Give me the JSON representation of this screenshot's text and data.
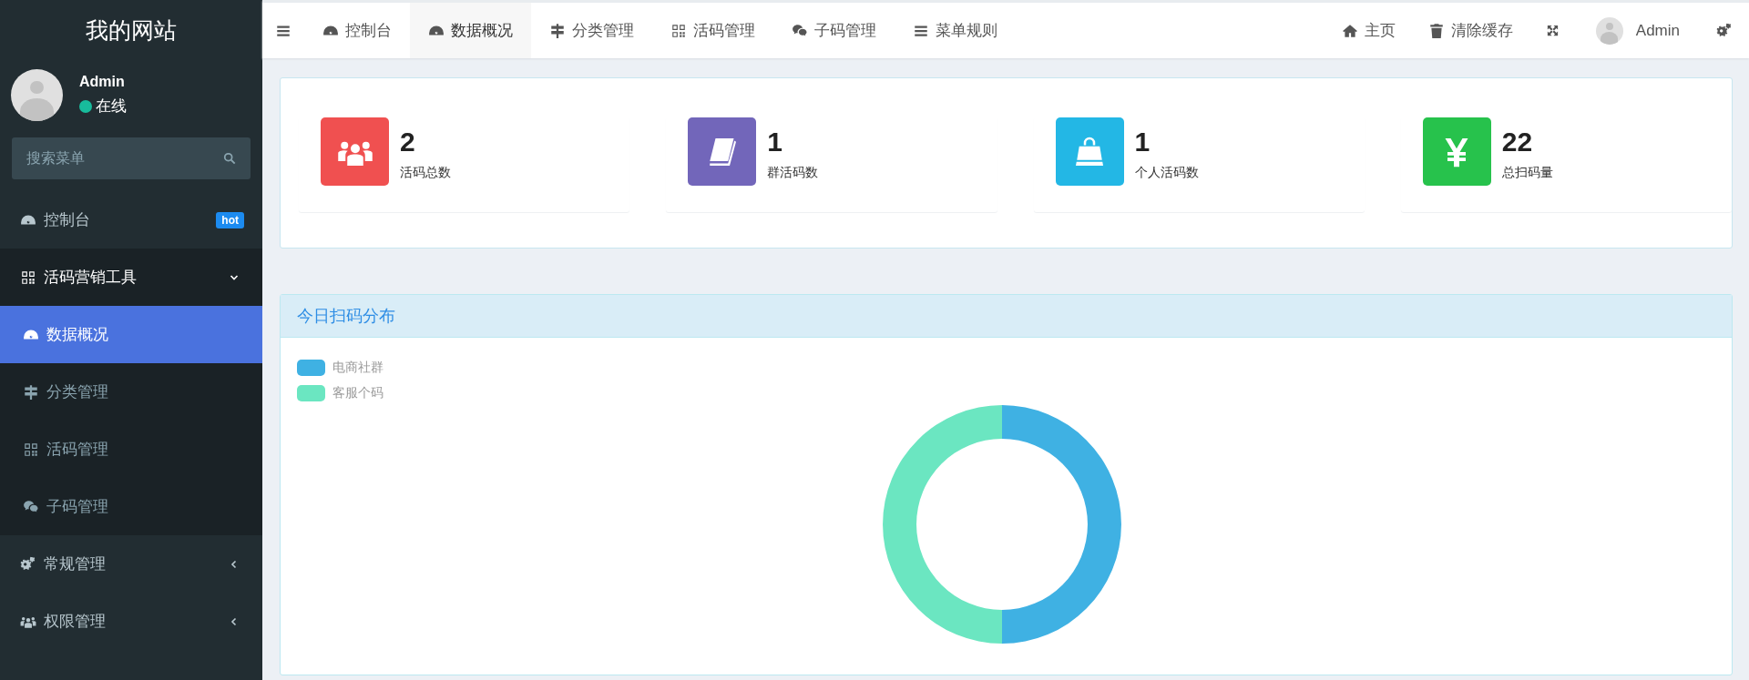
{
  "sidebar": {
    "site_title": "我的网站",
    "user": {
      "name": "Admin",
      "status": "在线"
    },
    "search": {
      "placeholder": "搜索菜单"
    },
    "items": [
      {
        "label": "控制台",
        "badge": "hot"
      },
      {
        "label": "活码营销工具",
        "expanded": true,
        "children": [
          {
            "label": "数据概况",
            "selected": true
          },
          {
            "label": "分类管理",
            "selected": false
          },
          {
            "label": "活码管理",
            "selected": false
          },
          {
            "label": "子码管理",
            "selected": false
          }
        ]
      },
      {
        "label": "常规管理",
        "expanded": false
      },
      {
        "label": "权限管理",
        "expanded": false
      }
    ]
  },
  "topbar": {
    "tabs": [
      {
        "label": "控制台",
        "selected": false
      },
      {
        "label": "数据概况",
        "selected": true
      },
      {
        "label": "分类管理",
        "selected": false
      },
      {
        "label": "活码管理",
        "selected": false
      },
      {
        "label": "子码管理",
        "selected": false
      },
      {
        "label": "菜单规则",
        "selected": false
      }
    ],
    "actions": [
      "主页",
      "清除缓存"
    ],
    "user": "Admin"
  },
  "stats": [
    {
      "value": "2",
      "label": "活码总数",
      "color": "#f05050"
    },
    {
      "value": "1",
      "label": "群活码数",
      "color": "#7266ba"
    },
    {
      "value": "1",
      "label": "个人活码数",
      "color": "#23b7e5"
    },
    {
      "value": "22",
      "label": "总扫码量",
      "color": "#27c24c"
    }
  ],
  "chart_panel": {
    "title": "今日扫码分布",
    "chart_data": {
      "type": "donut",
      "categories": [
        "电商社群",
        "客服个码"
      ],
      "values": [
        50,
        50
      ],
      "colors": [
        "#3fb1e3",
        "#6be6c1"
      ],
      "legend": "top-left"
    }
  }
}
